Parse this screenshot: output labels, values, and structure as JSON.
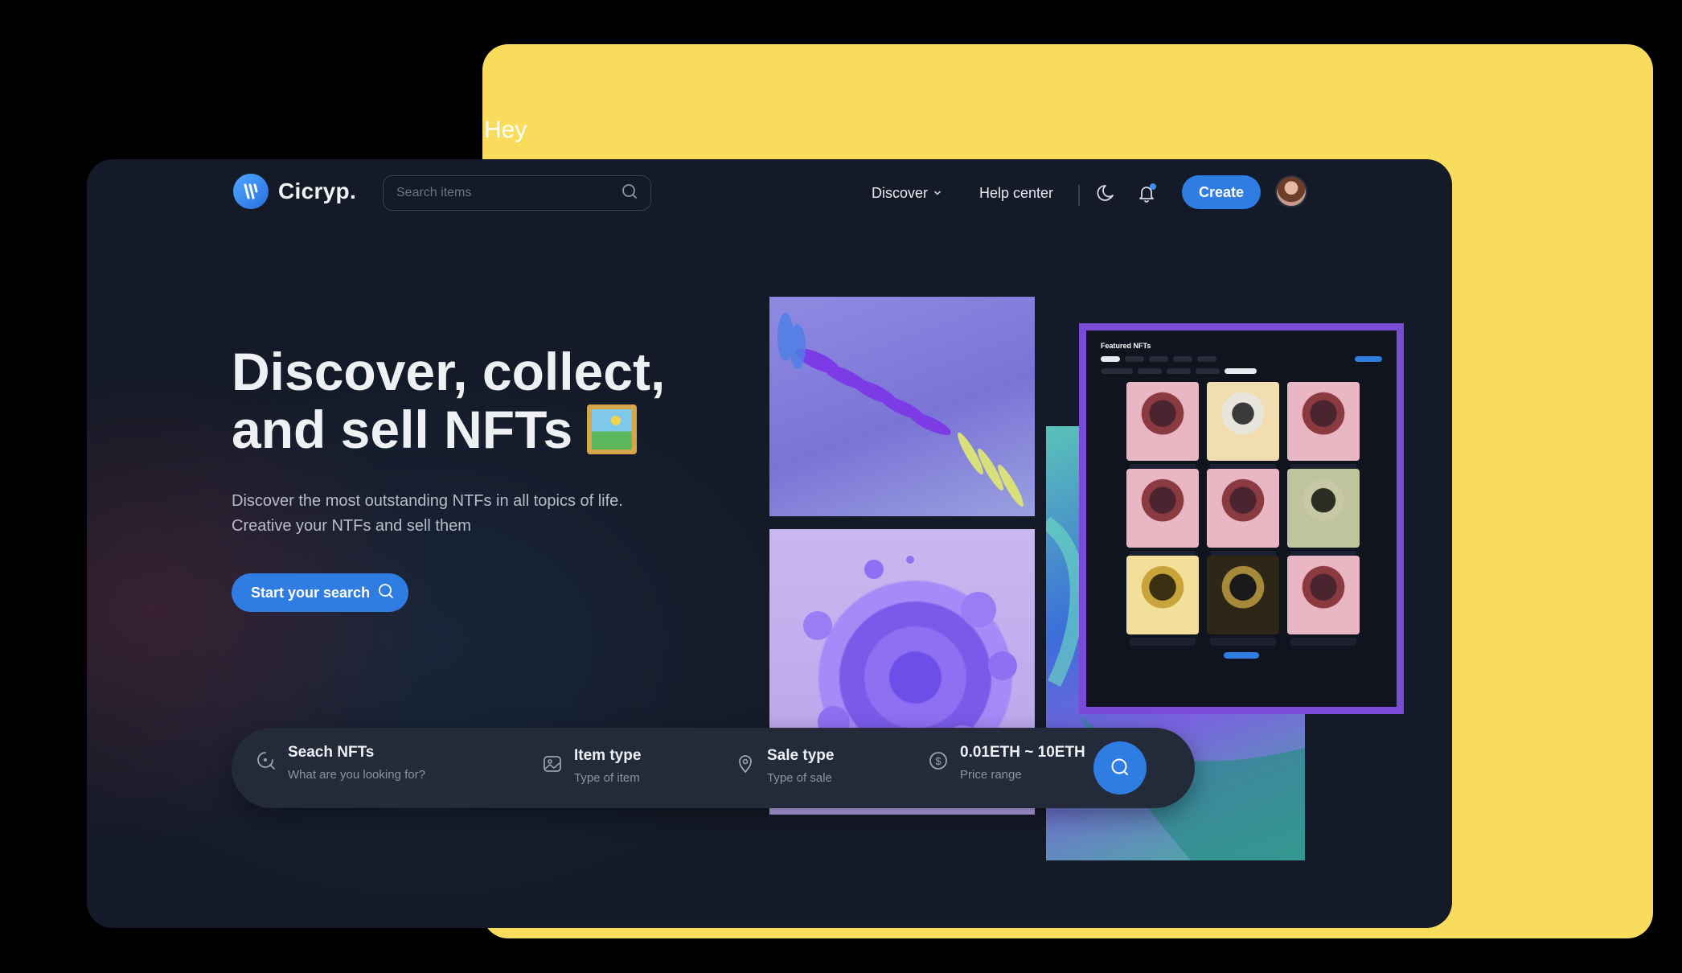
{
  "overlay": {
    "hey_text": "Hey"
  },
  "colors": {
    "accent": "#2f7de2",
    "background": "#141a27",
    "backdrop": "#f9dc5c",
    "frame": "#7a4bd6"
  },
  "header": {
    "logo_text": "Cicryp.",
    "search_placeholder": "Search items",
    "nav": {
      "discover": "Discover",
      "help_center": "Help center"
    },
    "create_label": "Create"
  },
  "hero": {
    "title_line1": "Discover, collect,",
    "title_line2": "and sell NFTs",
    "subtitle_line1": "Discover the most outstanding NTFs in all topics of life.",
    "subtitle_line2": "Creative your NTFs and sell them",
    "cta_label": "Start your search"
  },
  "featured": {
    "title": "Featured NFTs",
    "cards": [
      "pink",
      "cream",
      "pink",
      "pink",
      "pink",
      "olive",
      "gold",
      "dark",
      "pink"
    ]
  },
  "filter": {
    "search": {
      "title": "Seach NFTs",
      "sub": "What are you looking for?"
    },
    "item_type": {
      "title": "Item type",
      "sub": "Type of item"
    },
    "sale_type": {
      "title": "Sale type",
      "sub": "Type of sale"
    },
    "price": {
      "title": "0.01ETH ~ 10ETH",
      "sub": "Price range"
    }
  },
  "icons": [
    "search-icon",
    "chevron-down-icon",
    "moon-icon",
    "bell-icon",
    "image-icon",
    "map-pin-icon",
    "dollar-icon"
  ]
}
